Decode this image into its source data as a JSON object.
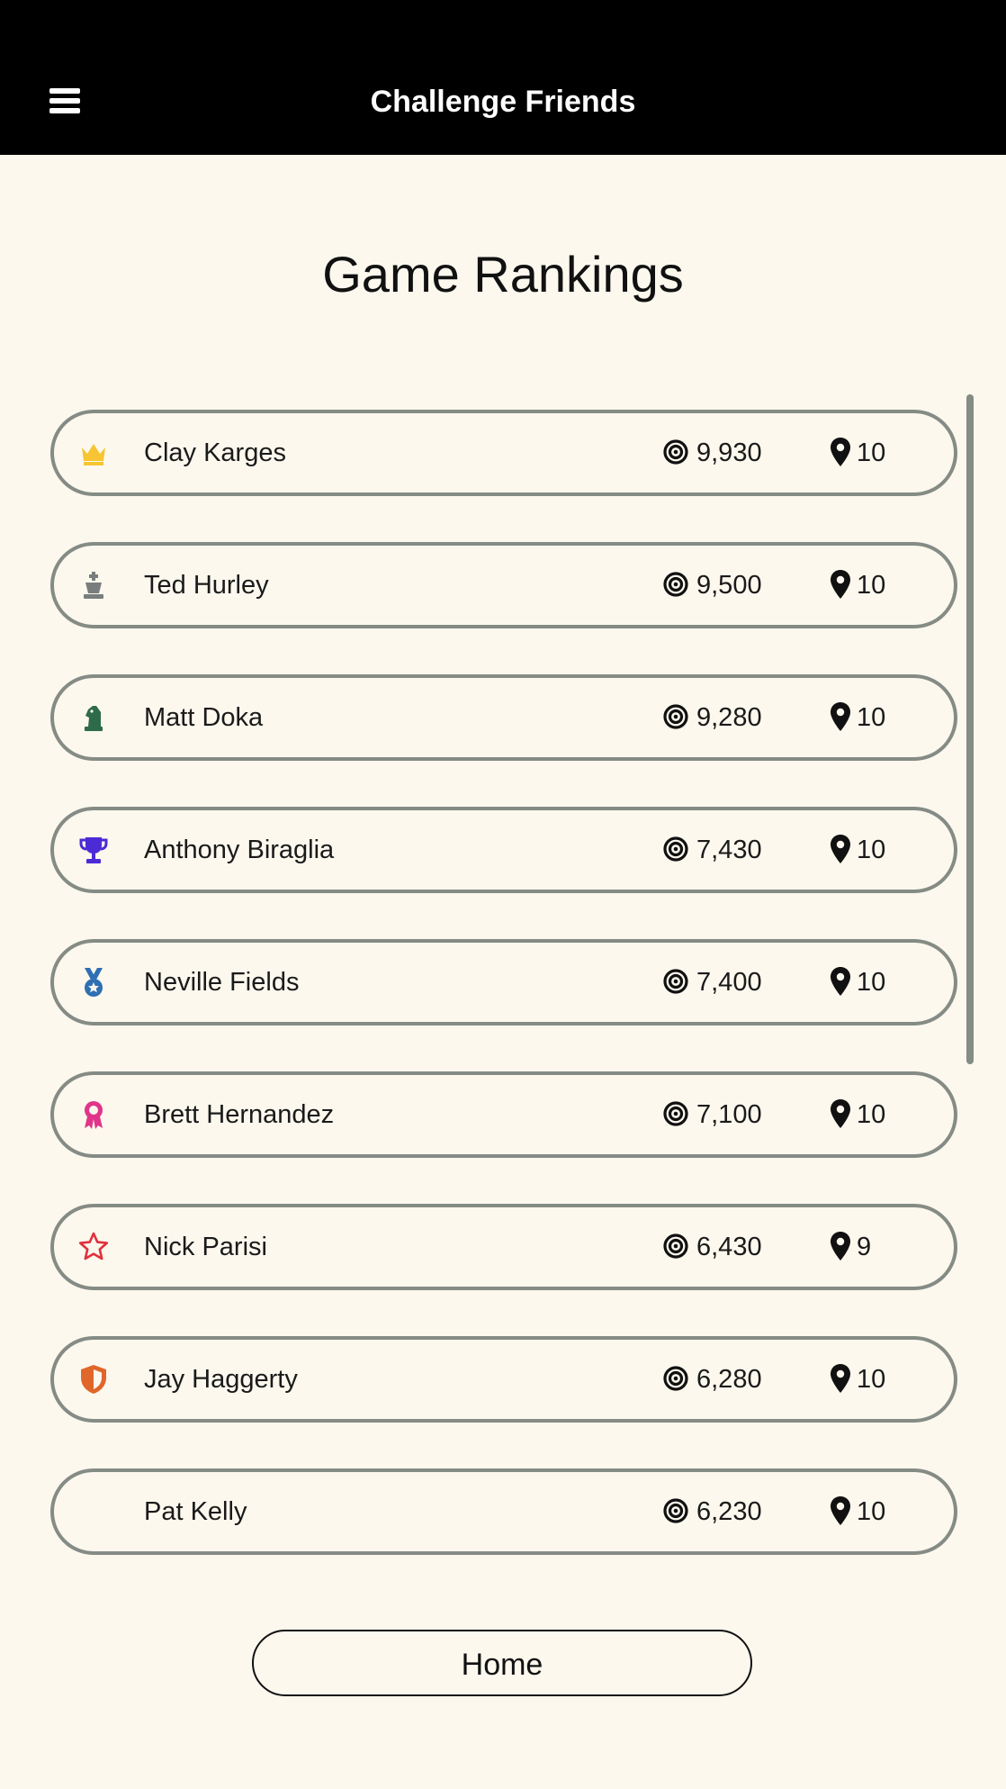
{
  "header": {
    "menu_icon": "hamburger-menu-icon",
    "title": "Challenge Friends"
  },
  "page_title": "Game Rankings",
  "rankings": [
    {
      "name": "Clay Karges",
      "score": "9,930",
      "level": "10",
      "icon": "crown-icon",
      "icon_color": "#f6c531"
    },
    {
      "name": "Ted Hurley",
      "score": "9,500",
      "level": "10",
      "icon": "chess-king-icon",
      "icon_color": "#7a7d7d"
    },
    {
      "name": "Matt Doka",
      "score": "9,280",
      "level": "10",
      "icon": "chess-knight-icon",
      "icon_color": "#2e6b4a"
    },
    {
      "name": "Anthony Biraglia",
      "score": "7,430",
      "level": "10",
      "icon": "trophy-icon",
      "icon_color": "#4b2bd6"
    },
    {
      "name": "Neville Fields",
      "score": "7,400",
      "level": "10",
      "icon": "medal-icon",
      "icon_color": "#2f6fb3"
    },
    {
      "name": "Brett Hernandez",
      "score": "7,100",
      "level": "10",
      "icon": "award-ribbon-icon",
      "icon_color": "#e0358a"
    },
    {
      "name": "Nick Parisi",
      "score": "6,430",
      "level": "9",
      "icon": "star-outline-icon",
      "icon_color": "#e0303c"
    },
    {
      "name": "Jay Haggerty",
      "score": "6,280",
      "level": "10",
      "icon": "shield-icon",
      "icon_color": "#e0662a"
    },
    {
      "name": "Pat Kelly",
      "score": "6,230",
      "level": "10",
      "icon": "",
      "icon_color": ""
    }
  ],
  "stat_icons": {
    "score": "target-icon",
    "level": "map-pin-icon"
  },
  "home_button": "Home"
}
